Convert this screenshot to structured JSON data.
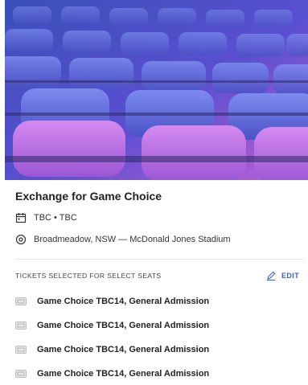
{
  "event": {
    "title": "Exchange for Game Choice",
    "date_time": "TBC • TBC",
    "venue": "Broadmeadow, NSW — McDonald Jones Stadium"
  },
  "tickets_section": {
    "heading": "TICKETS SELECTED FOR SELECT SEATS",
    "edit_label": "EDIT"
  },
  "tickets": [
    {
      "label": "Game Choice TBC14, General Admission"
    },
    {
      "label": "Game Choice TBC14, General Admission"
    },
    {
      "label": "Game Choice TBC14, General Admission"
    },
    {
      "label": "Game Choice TBC14, General Admission"
    }
  ],
  "icons": {
    "date": "calendar-icon",
    "venue": "location-pin-icon",
    "edit": "pencil-icon",
    "ticket": "ticket-icon"
  },
  "colors": {
    "accent": "#3a5fc8",
    "hero_top": "#2f4fb4",
    "hero_bottom": "#c46ad8"
  }
}
